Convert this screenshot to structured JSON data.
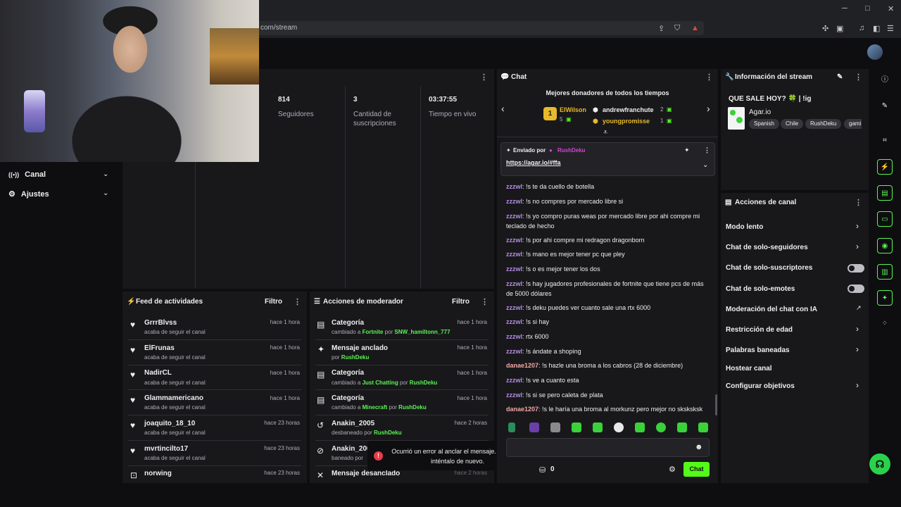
{
  "browser": {
    "url": "com/stream",
    "controls": {
      "minimize": "─",
      "maximize": "□",
      "close": "✕"
    }
  },
  "sidebar": {
    "items": [
      {
        "label": "Canal",
        "icon": "broadcast-icon"
      },
      {
        "label": "Ajustes",
        "icon": "gear-icon"
      }
    ]
  },
  "stats": [
    {
      "value": "814",
      "label": "Seguidores"
    },
    {
      "value": "3",
      "label": "Cantidad de suscripciones"
    },
    {
      "value": "03:37:55",
      "label": "Tiempo en vivo"
    }
  ],
  "activity_feed": {
    "title": "Feed de actividades",
    "filter": "Filtro",
    "rows": [
      {
        "name": "GrrrBlvss",
        "sub": "acaba de seguir el canal",
        "time": "hace 1 hora"
      },
      {
        "name": "ElFrunas",
        "sub": "acaba de seguir el canal",
        "time": "hace 1 hora"
      },
      {
        "name": "NadirCL",
        "sub": "acaba de seguir el canal",
        "time": "hace 1 hora"
      },
      {
        "name": "Glammamericano",
        "sub": "acaba de seguir el canal",
        "time": "hace 1 hora"
      },
      {
        "name": "joaquito_18_10",
        "sub": "acaba de seguir el canal",
        "time": "hace 23 horas"
      },
      {
        "name": "mvrtincilto17",
        "sub": "acaba de seguir el canal",
        "time": "hace 23 horas"
      },
      {
        "name": "norwing",
        "sub": "",
        "time": "hace 23 horas"
      }
    ]
  },
  "mod_actions": {
    "title": "Acciones de moderador",
    "filter": "Filtro",
    "rows": [
      {
        "title": "Categoría",
        "pre": "cambiado a ",
        "hl": "Fortnite",
        "mid": " por ",
        "by": "SNW_hamiltonn_777",
        "time": "hace 1 hora",
        "icon": "category-icon"
      },
      {
        "title": "Mensaje anclado",
        "pre": "por ",
        "hl": "",
        "mid": "",
        "by": "RushDeku",
        "time": "hace 1 hora",
        "icon": "pin-icon"
      },
      {
        "title": "Categoría",
        "pre": "cambiado a ",
        "hl": "Just Chatting",
        "mid": " por ",
        "by": "RushDeku",
        "time": "hace 1 hora",
        "icon": "category-icon"
      },
      {
        "title": "Categoría",
        "pre": "cambiado a ",
        "hl": "Minecraft",
        "mid": " por ",
        "by": "RushDeku",
        "time": "hace 1 hora",
        "icon": "category-icon"
      },
      {
        "title": "Anakin_2005",
        "pre": "desbaneado por ",
        "hl": "",
        "mid": "",
        "by": "RushDeku",
        "time": "hace 2 horas",
        "icon": "unban-icon"
      },
      {
        "title": "Anakin_200",
        "pre": "baneado por",
        "hl": "",
        "mid": "",
        "by": "",
        "time": "",
        "icon": "ban-icon"
      },
      {
        "title": "Mensaje desanclado",
        "pre": "",
        "hl": "",
        "mid": "",
        "by": "",
        "time": "hace 2 horas",
        "icon": "unpin-icon"
      }
    ]
  },
  "chat": {
    "title": "Chat",
    "donors_title": "Mejores donadores de todos los tiempos",
    "donors": [
      {
        "rank": "1",
        "name": "ElWilson",
        "amount": "5"
      },
      {
        "name": "andrewfranchute",
        "amount": "2"
      },
      {
        "name": "youngpromisse",
        "amount": "1"
      }
    ],
    "pinned_by_label": "Enviado por",
    "pinned_by_user": "RushDeku",
    "pinned_link": "https://agar.io/#ffa",
    "messages": [
      {
        "user": "zzzwl",
        "text": ": !s te da cuello de botella"
      },
      {
        "user": "zzzwl",
        "text": ": !s no compres por mercado libre si"
      },
      {
        "user": "zzzwl",
        "text": ": !s yo compro puras weas por mercado libre por ahi compre mi teclado de hecho"
      },
      {
        "user": "zzzwl",
        "text": ": !s por ahi compre mi redragon dragonborn"
      },
      {
        "user": "zzzwl",
        "text": ": !s mano es mejor tener pc que pley"
      },
      {
        "user": "zzzwl",
        "text": ": !s o es mejor tener los dos"
      },
      {
        "user": "zzzwl",
        "text": ": !s hay jugadores profesionales de fortnite que tiene pcs de más de 5000 dólares"
      },
      {
        "user": "zzzwl",
        "text": ": !s deku puedes ver cuanto sale una rtx 6000"
      },
      {
        "user": "zzzwl",
        "text": ": !s si hay"
      },
      {
        "user": "zzzwl",
        "text": ": rtx 6000"
      },
      {
        "user": "zzzwl",
        "text": ": !s ándate a shoping"
      },
      {
        "user": "danae1207",
        "text": ": !s hazle una broma a los cabros (28 de diciembre)"
      },
      {
        "user": "zzzwl",
        "text": ": !s ve a cuanto esta"
      },
      {
        "user": "zzzwl",
        "text": ": !s si se pero caleta de plata"
      },
      {
        "user": "danae1207",
        "text": ": !s le haría una broma al morkunz pero mejor no sksksksk"
      }
    ],
    "points": "0",
    "send_label": "Chat"
  },
  "toast": {
    "text": "Ocurrió un error al anclar el mensaje. Por favor inténtalo de nuevo."
  },
  "stream_info": {
    "title": "Información del stream",
    "stream_title": "QUE SALE HOY? 🍀 | !ig",
    "category": "Agar.io",
    "tags": [
      "Spanish",
      "Chile",
      "RushDeku",
      "gami"
    ]
  },
  "channel_actions": {
    "title": "Acciones de canal",
    "items": [
      {
        "label": "Modo lento",
        "control": "chevron"
      },
      {
        "label": "Chat de solo-seguidores",
        "control": "chevron"
      },
      {
        "label": "Chat de solo-suscriptores",
        "control": "toggle"
      },
      {
        "label": "Chat de solo-emotes",
        "control": "toggle"
      },
      {
        "label": "Moderación del chat con IA",
        "control": "external"
      },
      {
        "label": "Restricción de edad",
        "control": "chevron"
      },
      {
        "label": "Palabras baneadas",
        "control": "chevron"
      },
      {
        "label": "Hostear canal",
        "control": "none"
      },
      {
        "label": "Configurar objetivos",
        "control": "chevron"
      }
    ]
  },
  "colors": {
    "accent": "#53fc18",
    "panel": "#18181b",
    "background": "#0e0e10"
  }
}
